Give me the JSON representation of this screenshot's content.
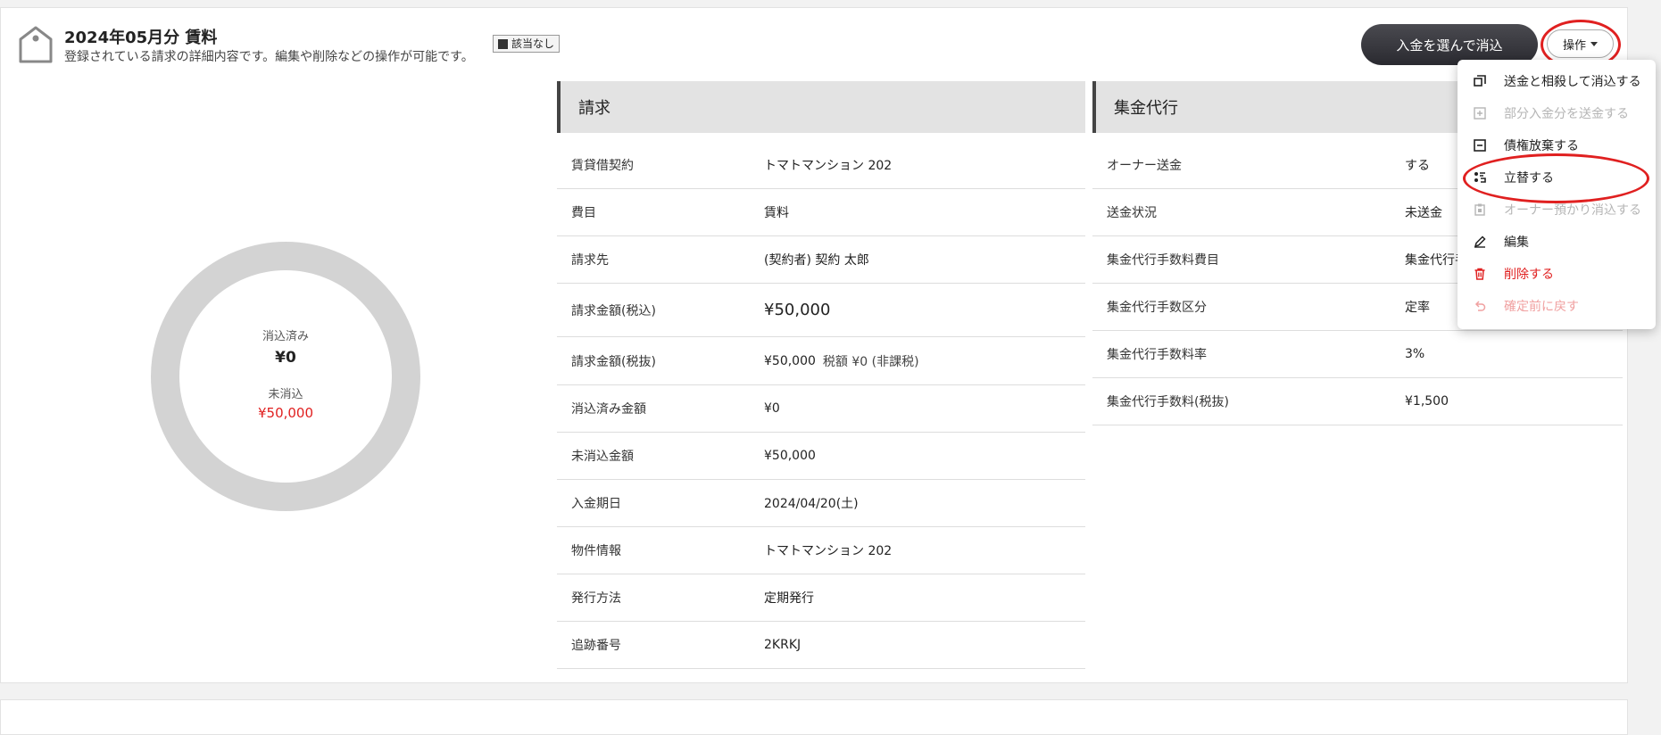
{
  "header": {
    "title": "2024年05月分 賃料",
    "subtitle": "登録されている請求の詳細内容です。編集や削除などの操作が可能です。",
    "badge": "該当なし",
    "reconcile_button": "入金を選んで消込",
    "operations_button": "操作"
  },
  "summary": {
    "reconciled_label": "消込済み",
    "reconciled_value": "¥0",
    "unreconciled_label": "未消込",
    "unreconciled_value": "¥50,000",
    "reconciled_fraction": 0
  },
  "billing": {
    "title": "請求",
    "rows": [
      {
        "label": "賃貸借契約",
        "value": "トマトマンション 202"
      },
      {
        "label": "費目",
        "value": "賃料"
      },
      {
        "label": "請求先",
        "value": "(契約者) 契約 太郎"
      },
      {
        "label": "請求金額(税込)",
        "value": "¥50,000"
      },
      {
        "label": "請求金額(税抜)",
        "value": "¥50,000",
        "extra": "税額 ¥0 (非課税)"
      },
      {
        "label": "消込済み金額",
        "value": "¥0"
      },
      {
        "label": "未消込金額",
        "value": "¥50,000"
      },
      {
        "label": "入金期日",
        "value": "2024/04/20(土)"
      },
      {
        "label": "物件情報",
        "value": "トマトマンション 202"
      },
      {
        "label": "発行方法",
        "value": "定期発行"
      },
      {
        "label": "追跡番号",
        "value": "2KRKJ"
      }
    ]
  },
  "collection": {
    "title": "集金代行",
    "rows": [
      {
        "label": "オーナー送金",
        "value": "する"
      },
      {
        "label": "送金状況",
        "value": "未送金"
      },
      {
        "label": "集金代行手数料費目",
        "value": "集金代行手"
      },
      {
        "label": "集金代行手数区分",
        "value": "定率"
      },
      {
        "label": "集金代行手数料率",
        "value": "3%"
      },
      {
        "label": "集金代行手数料(税抜)",
        "value": "¥1,500"
      }
    ]
  },
  "menu": {
    "items": [
      {
        "label": "送金と相殺して消込する",
        "icon": "offset-icon",
        "state": "enabled"
      },
      {
        "label": "部分入金分を送金する",
        "icon": "plus-square-icon",
        "state": "disabled"
      },
      {
        "label": "債権放棄する",
        "icon": "minus-square-icon",
        "state": "enabled"
      },
      {
        "label": "立替する",
        "icon": "advance-icon",
        "state": "enabled"
      },
      {
        "label": "オーナー預かり消込する",
        "icon": "clipboard-icon",
        "state": "disabled"
      },
      {
        "label": "編集",
        "icon": "pencil-icon",
        "state": "enabled"
      },
      {
        "label": "削除する",
        "icon": "trash-icon",
        "state": "danger"
      },
      {
        "label": "確定前に戻す",
        "icon": "undo-icon",
        "state": "danger-disabled"
      }
    ]
  },
  "colors": {
    "accent_red": "#e02020",
    "link_blue": "#1a73c8",
    "donut_gray": "#d3d3d3"
  }
}
